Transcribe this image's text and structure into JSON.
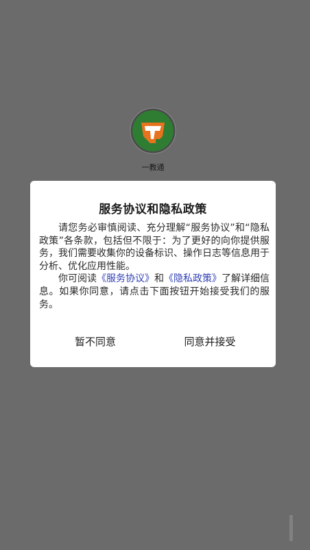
{
  "app": {
    "name": "一教通"
  },
  "dialog": {
    "title": "服务协议和隐私政策",
    "paragraph1": "请您务必审慎阅读、充分理解“服务协议”和“隐私政策”各条款，包括但不限于：为了更好的向你提供服务，我们需要收集你的设备标识、操作日志等信息用于分析、优化应用性能。",
    "paragraph2_prefix": "你可阅读",
    "service_link": "《服务协议》",
    "and_text": "和",
    "privacy_link": "《隐私政策》",
    "paragraph2_suffix": "了解详细信息。如果你同意，请点击下面按钮开始接受我们的服务。",
    "decline_label": "暂不同意",
    "accept_label": "同意并接受"
  },
  "colors": {
    "overlay": "#6b6b6b",
    "link": "#2f3fb4",
    "logo_green": "#2e7d32",
    "logo_orange": "#e8731f"
  }
}
